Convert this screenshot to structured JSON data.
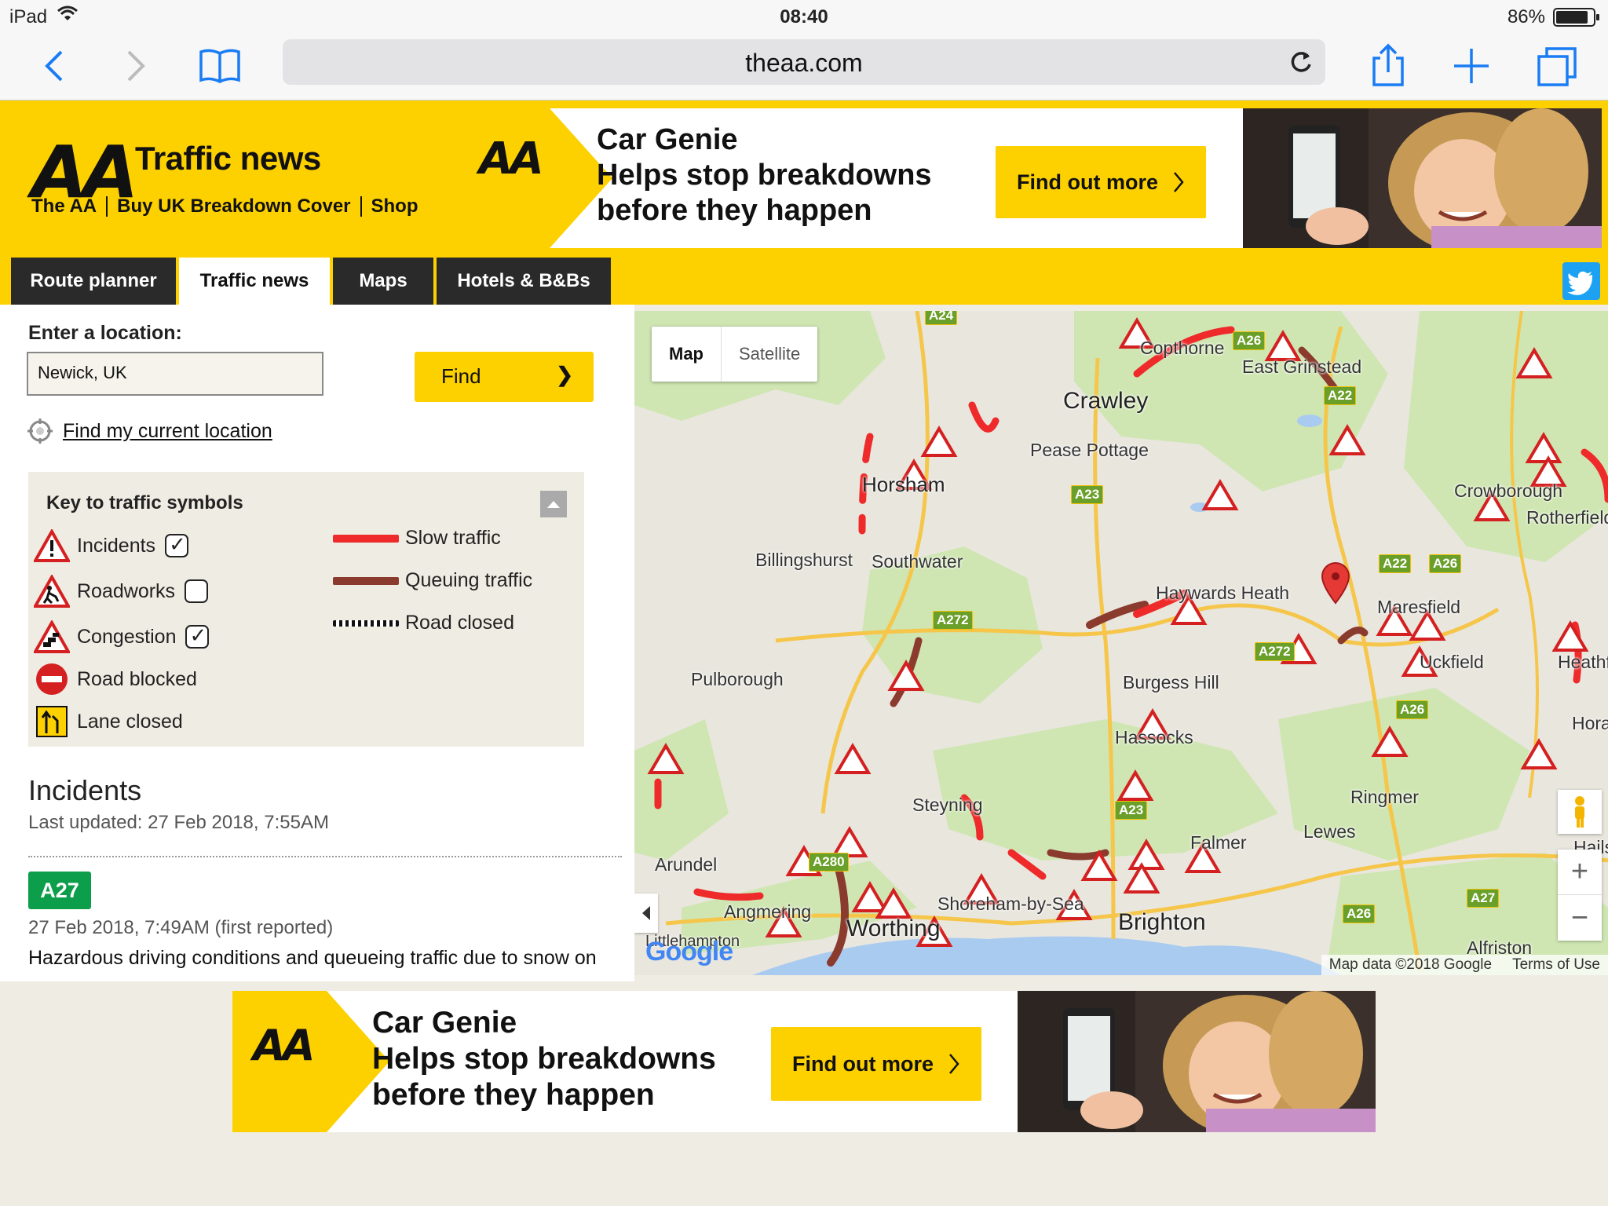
{
  "status_bar": {
    "device": "iPad",
    "time": "08:40",
    "battery": "86%"
  },
  "browser": {
    "url": "theaa.com"
  },
  "aa_header": {
    "logo": "AA",
    "title": "Traffic news",
    "links": [
      "The AA",
      "Buy UK Breakdown Cover",
      "Shop"
    ]
  },
  "ad": {
    "logo": "AA",
    "line1": "Car Genie",
    "line2": "Helps stop breakdowns",
    "line3": "before they happen",
    "cta": "Find out more"
  },
  "nav": {
    "tabs": [
      "Route planner",
      "Traffic news",
      "Maps",
      "Hotels & B&Bs"
    ],
    "active": "Traffic news"
  },
  "search": {
    "label": "Enter a location:",
    "value": "Newick, UK",
    "find_label": "Find",
    "find_chevron": "❯",
    "current_location": "Find my current location"
  },
  "key": {
    "title": "Key to traffic symbols",
    "symbols": [
      {
        "label": "Incidents",
        "checked": true
      },
      {
        "label": "Roadworks",
        "checked": false
      },
      {
        "label": "Congestion",
        "checked": true
      },
      {
        "label": "Road blocked"
      },
      {
        "label": "Lane closed"
      }
    ],
    "lines": [
      {
        "label": "Slow traffic",
        "color": "#ee2a2a"
      },
      {
        "label": "Queuing traffic",
        "color": "#8b3a2e"
      },
      {
        "label": "Road closed",
        "pattern": "checkered"
      }
    ]
  },
  "incidents": {
    "title": "Incidents",
    "updated": "Last updated: 27 Feb 2018, 7:55AM",
    "items": [
      {
        "road": "A27",
        "time": "27 Feb 2018, 7:49AM (first reported)",
        "desc": "Hazardous driving conditions and queueing traffic due to snow on"
      }
    ]
  },
  "map": {
    "type_buttons": [
      "Map",
      "Satellite"
    ],
    "places": [
      {
        "name": "Copthorne",
        "size": "normal"
      },
      {
        "name": "East Grinstead",
        "size": "normal"
      },
      {
        "name": "Crawley",
        "size": "big"
      },
      {
        "name": "Pease Pottage",
        "size": "normal"
      },
      {
        "name": "Horsham",
        "size": "big"
      },
      {
        "name": "Billingshurst",
        "size": "normal"
      },
      {
        "name": "Southwater",
        "size": "normal"
      },
      {
        "name": "Crowborough",
        "size": "normal"
      },
      {
        "name": "Rotherfield",
        "size": "normal"
      },
      {
        "name": "Haywards Heath",
        "size": "normal"
      },
      {
        "name": "Maresfield",
        "size": "normal"
      },
      {
        "name": "Uckfield",
        "size": "normal"
      },
      {
        "name": "Pulborough",
        "size": "normal"
      },
      {
        "name": "Burgess Hill",
        "size": "normal"
      },
      {
        "name": "Hassocks",
        "size": "normal"
      },
      {
        "name": "Steyning",
        "size": "normal"
      },
      {
        "name": "Ringmer",
        "size": "normal"
      },
      {
        "name": "Lewes",
        "size": "normal"
      },
      {
        "name": "Arundel",
        "size": "normal"
      },
      {
        "name": "Falmer",
        "size": "normal"
      },
      {
        "name": "Angmering",
        "size": "normal"
      },
      {
        "name": "Shoreham-by-Sea",
        "size": "normal"
      },
      {
        "name": "Worthing",
        "size": "big"
      },
      {
        "name": "Brighton",
        "size": "big"
      },
      {
        "name": "Littlehampton",
        "size": "normal"
      },
      {
        "name": "Alfriston",
        "size": "normal"
      },
      {
        "name": "Heathfield",
        "size": "normal"
      },
      {
        "name": "Horam",
        "size": "normal"
      },
      {
        "name": "Hailsham",
        "size": "normal"
      }
    ],
    "roads": [
      "A26",
      "A22",
      "A23",
      "A272",
      "A272",
      "A22",
      "A26",
      "A26",
      "A26",
      "A27",
      "A24",
      "A280",
      "A23"
    ],
    "zoom_in": "+",
    "zoom_out": "−",
    "attribution": "Map data ©2018 Google",
    "terms": "Terms of Use",
    "google": "Google",
    "colors": {
      "slow": "#ee2a2a",
      "queue": "#8b3a2e",
      "sea": "#a9cbf0",
      "green": "#cfe6b2"
    }
  }
}
